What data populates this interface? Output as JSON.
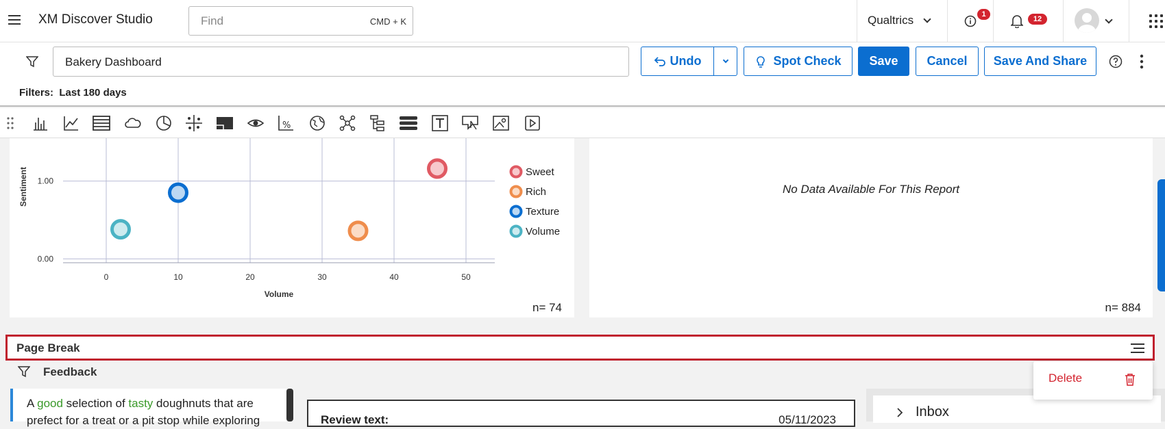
{
  "topbar": {
    "app_title": "XM Discover Studio",
    "find_placeholder": "Find",
    "find_shortcut": "CMD + K",
    "org_name": "Qualtrics",
    "alerts_count": "1",
    "notifications_count": "12"
  },
  "dashbar": {
    "dashboard_name": "Bakery Dashboard",
    "undo_label": "Undo",
    "spot_check_label": "Spot Check",
    "save_label": "Save",
    "cancel_label": "Cancel",
    "save_share_label": "Save And Share",
    "filters_label": "Filters:",
    "filters_value": "Last 180 days"
  },
  "scatter": {
    "n_label": "n= 74"
  },
  "nodata": {
    "message": "No Data Available For This Report",
    "n_label": "n= 884"
  },
  "chart_data": {
    "type": "scatter",
    "xlabel": "Volume",
    "ylabel": "Sentiment",
    "x_ticks": [
      "0",
      "10",
      "20",
      "30",
      "40",
      "50"
    ],
    "y_ticks": [
      "0.00",
      "1.00"
    ],
    "xlim": [
      -6,
      54
    ],
    "ylim": [
      -0.05,
      1.55
    ],
    "legend_position": "right",
    "series": [
      {
        "name": "Sweet",
        "color": "#e05a63",
        "fill": "#f7c9cc",
        "x": 46,
        "y": 1.16
      },
      {
        "name": "Rich",
        "color": "#ef8d4c",
        "fill": "#fbdcc6",
        "x": 35,
        "y": 0.36
      },
      {
        "name": "Texture",
        "color": "#0b6ed0",
        "fill": "#bcd8f3",
        "x": 10,
        "y": 0.85
      },
      {
        "name": "Volume",
        "color": "#4bb3c4",
        "fill": "#cdebef",
        "x": 2,
        "y": 0.38
      }
    ]
  },
  "page_break": {
    "title": "Page Break",
    "delete_label": "Delete"
  },
  "feedback": {
    "title": "Feedback",
    "text_part1": "A ",
    "text_pos1": "good",
    "text_part2": " selection of ",
    "text_pos2": "tasty",
    "text_part3": " doughnuts that are prefect for a treat or a pit stop while exploring",
    "review_label": "Review text:",
    "review_date": "05/11/2023",
    "inbox_label": "Inbox"
  }
}
